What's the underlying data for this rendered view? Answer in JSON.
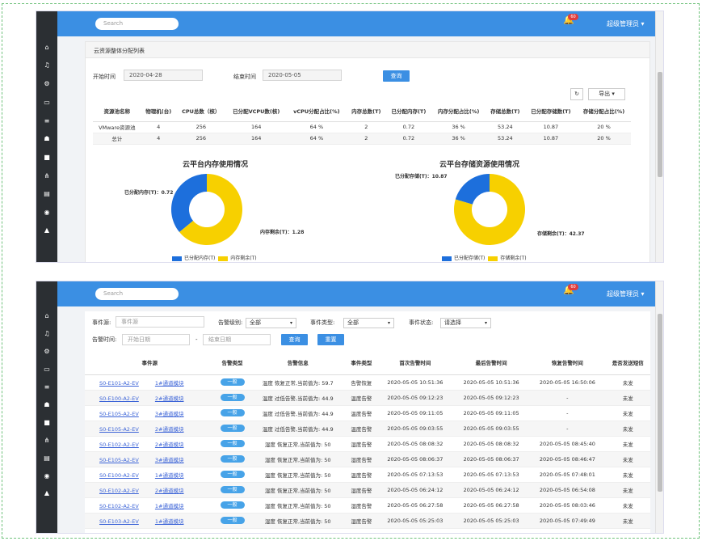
{
  "screen1": {
    "search_placeholder": "Search",
    "badge": "60",
    "admin": "超级管理员",
    "panel_title": "云资源整体分配列表",
    "start_label": "开始时间",
    "start_value": "2020-04-28",
    "end_label": "结束时间",
    "end_value": "2020-05-05",
    "query": "查询",
    "export": "导出",
    "refresh_icon": "refresh-icon",
    "columns": [
      "资源池名称",
      "物理机(台)",
      "CPU总数（核）",
      "已分配VCPU数(核)",
      "vCPU分配占比(%)",
      "内存总数(T)",
      "已分配内存(T)",
      "内存分配占比(%)",
      "存储总数(T)",
      "已分配存储数(T)",
      "存储分配占比(%)"
    ],
    "rows": [
      [
        "VMware资源池",
        "4",
        "256",
        "164",
        "64 %",
        "2",
        "0.72",
        "36 %",
        "53.24",
        "10.87",
        "20 %"
      ],
      [
        "总计",
        "4",
        "256",
        "164",
        "64 %",
        "2",
        "0.72",
        "36 %",
        "53.24",
        "10.87",
        "20 %"
      ]
    ]
  },
  "chart_data": [
    {
      "type": "pie",
      "title": "云平台内存使用情况",
      "labels": [
        "已分配内存(T)",
        "内存剩余(T)"
      ],
      "values": [
        0.72,
        1.28
      ],
      "annotations": [
        "已分配内存(T)：0.72",
        "内存剩余(T)：1.28"
      ],
      "colors": [
        "#1d6fdc",
        "#f7d000"
      ],
      "legend": "bottom"
    },
    {
      "type": "pie",
      "title": "云平台存储资源使用情况",
      "labels": [
        "已分配存储(T)",
        "存储剩余(T)"
      ],
      "values": [
        10.87,
        42.37
      ],
      "annotations": [
        "已分配存储(T)：10.87",
        "存储剩余(T)：42.37"
      ],
      "colors": [
        "#1d6fdc",
        "#f7d000"
      ],
      "legend": "bottom"
    }
  ],
  "screen2": {
    "search_placeholder": "Search",
    "badge": "60",
    "admin": "超级管理员",
    "f_event_label": "事件源:",
    "f_event_placeholder": "事件源",
    "f_level_label": "告警级别:",
    "f_level_value": "全部",
    "f_type_label": "事件类型:",
    "f_type_value": "全部",
    "f_status_label": "事件状态:",
    "f_status_value": "请选择",
    "f_time_label": "告警时间:",
    "f_start_placeholder": "开始日期",
    "f_sep": "-",
    "f_end_placeholder": "结束日期",
    "query": "查询",
    "clear": "重置",
    "columns": [
      "事件源",
      "告警类型",
      "告警信息",
      "事件类型",
      "首次告警时间",
      "最后告警时间",
      "恢复告警时间",
      "是否发送短信"
    ],
    "rows": [
      [
        "S0-E101-A2-EV",
        "1#通道模块",
        "一般",
        "温度 恢复正常,当前值为: 59.7",
        "告警恢复",
        "2020-05-05 10:51:36",
        "2020-05-05 10:51:36",
        "2020-05-05 16:50:06",
        "未发"
      ],
      [
        "S0-E100-A2-EV",
        "2#通道模块",
        "一般",
        "温度 过低告警,当前值为: 44.9",
        "温度告警",
        "2020-05-05 09:12:23",
        "2020-05-05 09:12:23",
        "-",
        "未发"
      ],
      [
        "S0-E105-A2-EV",
        "3#通道模块",
        "一般",
        "温度 过低告警,当前值为: 44.9",
        "温度告警",
        "2020-05-05 09:11:05",
        "2020-05-05 09:11:05",
        "-",
        "未发"
      ],
      [
        "S0-E105-A2-EV",
        "2#通道模块",
        "一般",
        "温度 过低告警,当前值为: 44.9",
        "温度告警",
        "2020-05-05 09:03:55",
        "2020-05-05 09:03:55",
        "-",
        "未发"
      ],
      [
        "S0-E102-A2-EV",
        "2#通道模块",
        "一般",
        "湿度 恢复正常,当前值为: 50",
        "湿度告警",
        "2020-05-05 08:08:32",
        "2020-05-05 08:08:32",
        "2020-05-05 08:45:40",
        "未发"
      ],
      [
        "S0-E105-A2-EV",
        "3#通道模块",
        "一般",
        "湿度 恢复正常,当前值为: 50",
        "湿度告警",
        "2020-05-05 08:06:37",
        "2020-05-05 08:06:37",
        "2020-05-05 08:46:47",
        "未发"
      ],
      [
        "S0-E100-A2-EV",
        "1#通道模块",
        "一般",
        "温度 恢复正常,当前值为: 50",
        "温度告警",
        "2020-05-05 07:13:53",
        "2020-05-05 07:13:53",
        "2020-05-05 07:48:01",
        "未发"
      ],
      [
        "S0-E102-A2-EV",
        "2#通道模块",
        "一般",
        "湿度 恢复正常,当前值为: 50",
        "湿度告警",
        "2020-05-05 06:24:12",
        "2020-05-05 06:24:12",
        "2020-05-05 06:54:08",
        "未发"
      ],
      [
        "S0-E102-A2-EV",
        "1#通道模块",
        "一般",
        "湿度 恢复正常,当前值为: 50",
        "湿度告警",
        "2020-05-05 06:27:58",
        "2020-05-05 06:27:58",
        "2020-05-05 08:03:46",
        "未发"
      ],
      [
        "S0-E103-A2-EV",
        "1#通道模块",
        "一般",
        "湿度 恢复正常,当前值为: 50",
        "湿度告警",
        "2020-05-05 05:25:03",
        "2020-05-05 05:25:03",
        "2020-05-05 07:49:49",
        "未发"
      ]
    ]
  },
  "sidebar_icons": [
    "home-icon",
    "alarm-icon",
    "cogs-icon",
    "monitor-icon",
    "list-icon",
    "users-icon",
    "camera-icon",
    "sitemap-icon",
    "table-icon",
    "eye-icon",
    "user-icon"
  ]
}
